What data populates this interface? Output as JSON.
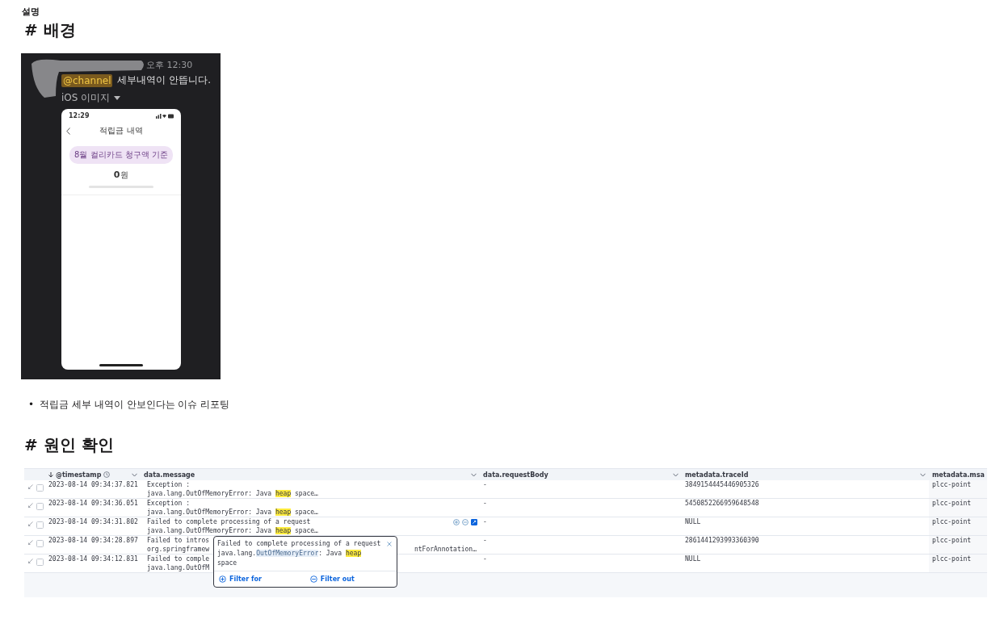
{
  "description_label": "설명",
  "background": {
    "heading": "# 배경",
    "screenshot": {
      "time": "오후 12:30",
      "mention": "@channel",
      "message": "세부내역이 안뜹니다.",
      "attachment_label": "iOS 이미지",
      "phone": {
        "status_time": "12:29",
        "title": "적립금 내역",
        "pill": "8월 컬리카드 청구액 기준",
        "amount": "0",
        "unit": "원"
      }
    },
    "bullets": [
      {
        "marker": "•",
        "text": "적립금 세부 내역이 안보인다는 이슈 리포팅"
      }
    ]
  },
  "cause": {
    "heading": "# 원인 확인",
    "log_table": {
      "columns": [
        {
          "label": "@timestamp",
          "sorted": true
        },
        {
          "label": "data.message",
          "sorted": false
        },
        {
          "label": "data.requestBody",
          "sorted": false
        },
        {
          "label": "metadata.traceId",
          "sorted": false
        },
        {
          "label": "metadata.msa",
          "sorted": false
        }
      ],
      "rows": [
        {
          "checked": false,
          "timestamp": "2023-08-14 09:34:37.821",
          "message_lines": [
            [
              {
                "text": "Exception :",
                "kind": "plain"
              }
            ],
            [
              {
                "text": "java.lang.OutOfMemoryError: Java ",
                "kind": "plain"
              },
              {
                "text": "heap",
                "kind": "highlight"
              },
              {
                "text": " space…",
                "kind": "plain"
              }
            ]
          ],
          "request_body": "-",
          "trace_id": "3849154445446905326",
          "msa": "plcc-point",
          "actions_shown": false
        },
        {
          "checked": false,
          "timestamp": "2023-08-14 09:34:36.051",
          "message_lines": [
            [
              {
                "text": "Exception :",
                "kind": "plain"
              }
            ],
            [
              {
                "text": "java.lang.OutOfMemoryError: Java ",
                "kind": "plain"
              },
              {
                "text": "heap",
                "kind": "highlight"
              },
              {
                "text": " space…",
                "kind": "plain"
              }
            ]
          ],
          "request_body": "-",
          "trace_id": "5450852266959648548",
          "msa": "plcc-point",
          "actions_shown": false
        },
        {
          "checked": false,
          "timestamp": "2023-08-14 09:34:31.802",
          "message_lines": [
            [
              {
                "text": "Failed to complete processing of a request",
                "kind": "plain"
              }
            ],
            [
              {
                "text": "java.lang.OutOfMemoryError: Java ",
                "kind": "plain"
              },
              {
                "text": "heap",
                "kind": "highlight"
              },
              {
                "text": " space…",
                "kind": "plain"
              }
            ]
          ],
          "request_body": "-",
          "trace_id": "NULL",
          "msa": "plcc-point",
          "actions_shown": true
        },
        {
          "checked": false,
          "timestamp": "2023-08-14 09:34:28.897",
          "message_lines": [
            [
              {
                "text": "Failed to intros",
                "kind": "plain"
              }
            ],
            [
              {
                "text": "org.springframew",
                "kind": "plain"
              }
            ]
          ],
          "message_tail": "ntForAnnotation…",
          "request_body": "-",
          "trace_id": "2861441293993360390",
          "msa": "plcc-point",
          "actions_shown": false
        },
        {
          "checked": false,
          "timestamp": "2023-08-14 09:34:12.831",
          "message_lines": [
            [
              {
                "text": "Failed to comple",
                "kind": "plain"
              }
            ],
            [
              {
                "text": "java.lang.OutOfM",
                "kind": "plain"
              }
            ]
          ],
          "request_body": "-",
          "trace_id": "NULL",
          "msa": "plcc-point",
          "actions_shown": false
        }
      ],
      "popover": {
        "lines": [
          [
            {
              "text": "Failed to complete processing of a request",
              "kind": "plain"
            }
          ],
          [
            {
              "text": "java.lang.",
              "kind": "plain"
            },
            {
              "text": "OutOfMemoryError",
              "kind": "token"
            },
            {
              "text": ": Java ",
              "kind": "plain"
            },
            {
              "text": "heap",
              "kind": "highlight"
            }
          ],
          [
            {
              "text": "space",
              "kind": "plain"
            }
          ]
        ],
        "filter_for": "Filter for",
        "filter_out": "Filter out"
      }
    }
  }
}
